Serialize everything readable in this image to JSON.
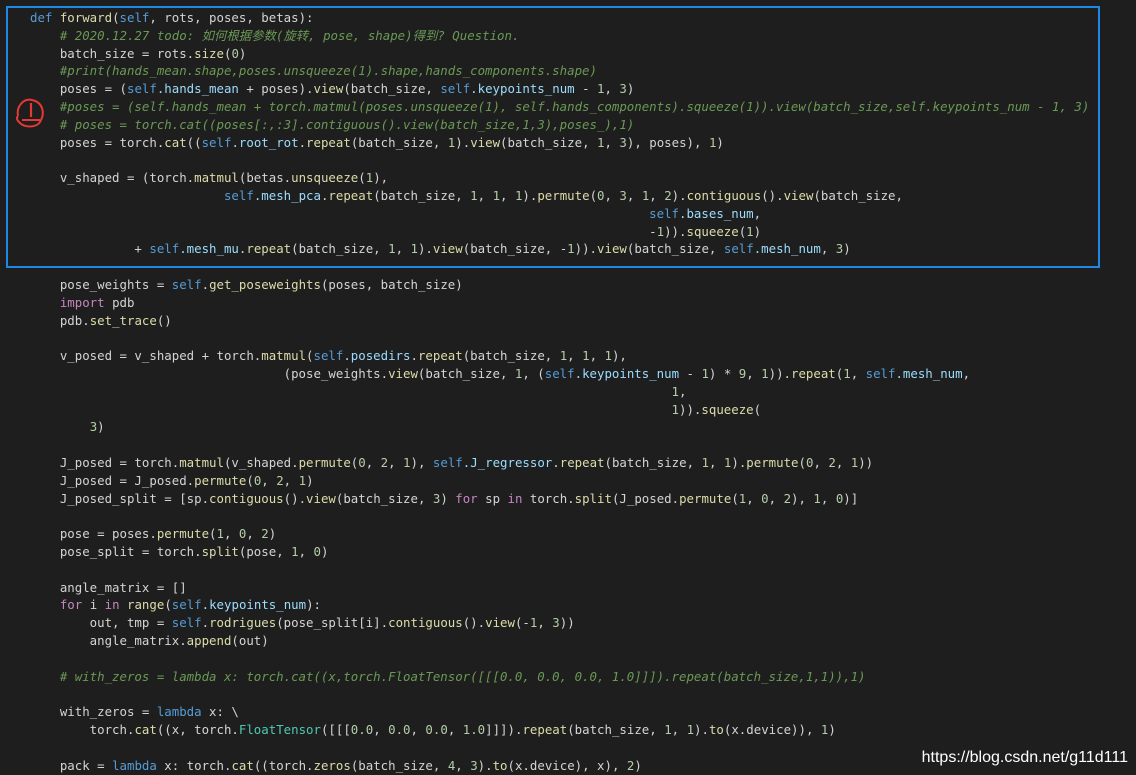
{
  "colors": {
    "background": "#1e1e1e",
    "keyword": "#569cd6",
    "control": "#c586c0",
    "function": "#dcdcaa",
    "attribute": "#9cdcfe",
    "number": "#b5cea8",
    "comment": "#6a9955",
    "highlight_box": "#1e88e5",
    "annotation_mark": "#e53935"
  },
  "code_lines": [
    [
      {
        "t": "def ",
        "c": "kw"
      },
      {
        "t": "forward",
        "c": "fn"
      },
      {
        "t": "(",
        "c": ""
      },
      {
        "t": "self",
        "c": "kw"
      },
      {
        "t": ", rots, poses, betas):",
        "c": ""
      }
    ],
    [
      {
        "t": "    # 2020.12.27 todo: 如何根据参数(旋转, pose, shape)得到? Question.",
        "c": "cm"
      }
    ],
    [
      {
        "t": "    batch_size = rots.",
        "c": ""
      },
      {
        "t": "size",
        "c": "fn"
      },
      {
        "t": "(",
        "c": ""
      },
      {
        "t": "0",
        "c": "num"
      },
      {
        "t": ")",
        "c": ""
      }
    ],
    [
      {
        "t": "    #print(hands_mean.shape,poses.unsqueeze(1).shape,hands_components.shape)",
        "c": "cm"
      }
    ],
    [
      {
        "t": "    poses = (",
        "c": ""
      },
      {
        "t": "self",
        "c": "kw"
      },
      {
        "t": ".hands_mean",
        "c": "attr"
      },
      {
        "t": " + poses).",
        "c": ""
      },
      {
        "t": "view",
        "c": "fn"
      },
      {
        "t": "(batch_size, ",
        "c": ""
      },
      {
        "t": "self",
        "c": "kw"
      },
      {
        "t": ".keypoints_num",
        "c": "attr"
      },
      {
        "t": " - ",
        "c": ""
      },
      {
        "t": "1",
        "c": "num"
      },
      {
        "t": ", ",
        "c": ""
      },
      {
        "t": "3",
        "c": "num"
      },
      {
        "t": ")",
        "c": ""
      }
    ],
    [
      {
        "t": "    #poses = (self.hands_mean + torch.matmul(poses.unsqueeze(1), self.hands_components).squeeze(1)).view(batch_size,self.keypoints_num - 1, 3)",
        "c": "cm"
      }
    ],
    [
      {
        "t": "    # poses = torch.cat((poses[:,:3].contiguous().view(batch_size,1,3),poses_),1)",
        "c": "cm"
      }
    ],
    [
      {
        "t": "    poses = torch.",
        "c": ""
      },
      {
        "t": "cat",
        "c": "fn"
      },
      {
        "t": "((",
        "c": ""
      },
      {
        "t": "self",
        "c": "kw"
      },
      {
        "t": ".root_rot",
        "c": "attr"
      },
      {
        "t": ".",
        "c": ""
      },
      {
        "t": "repeat",
        "c": "fn"
      },
      {
        "t": "(batch_size, ",
        "c": ""
      },
      {
        "t": "1",
        "c": "num"
      },
      {
        "t": ").",
        "c": ""
      },
      {
        "t": "view",
        "c": "fn"
      },
      {
        "t": "(batch_size, ",
        "c": ""
      },
      {
        "t": "1",
        "c": "num"
      },
      {
        "t": ", ",
        "c": ""
      },
      {
        "t": "3",
        "c": "num"
      },
      {
        "t": "), poses), ",
        "c": ""
      },
      {
        "t": "1",
        "c": "num"
      },
      {
        "t": ")",
        "c": ""
      }
    ],
    [
      {
        "t": "",
        "c": ""
      }
    ],
    [
      {
        "t": "    v_shaped = (torch.",
        "c": ""
      },
      {
        "t": "matmul",
        "c": "fn"
      },
      {
        "t": "(betas.",
        "c": ""
      },
      {
        "t": "unsqueeze",
        "c": "fn"
      },
      {
        "t": "(",
        "c": ""
      },
      {
        "t": "1",
        "c": "num"
      },
      {
        "t": "),",
        "c": ""
      }
    ],
    [
      {
        "t": "                          ",
        "c": ""
      },
      {
        "t": "self",
        "c": "kw"
      },
      {
        "t": ".mesh_pca",
        "c": "attr"
      },
      {
        "t": ".",
        "c": ""
      },
      {
        "t": "repeat",
        "c": "fn"
      },
      {
        "t": "(batch_size, ",
        "c": ""
      },
      {
        "t": "1",
        "c": "num"
      },
      {
        "t": ", ",
        "c": ""
      },
      {
        "t": "1",
        "c": "num"
      },
      {
        "t": ", ",
        "c": ""
      },
      {
        "t": "1",
        "c": "num"
      },
      {
        "t": ").",
        "c": ""
      },
      {
        "t": "permute",
        "c": "fn"
      },
      {
        "t": "(",
        "c": ""
      },
      {
        "t": "0",
        "c": "num"
      },
      {
        "t": ", ",
        "c": ""
      },
      {
        "t": "3",
        "c": "num"
      },
      {
        "t": ", ",
        "c": ""
      },
      {
        "t": "1",
        "c": "num"
      },
      {
        "t": ", ",
        "c": ""
      },
      {
        "t": "2",
        "c": "num"
      },
      {
        "t": ").",
        "c": ""
      },
      {
        "t": "contiguous",
        "c": "fn"
      },
      {
        "t": "().",
        "c": ""
      },
      {
        "t": "view",
        "c": "fn"
      },
      {
        "t": "(batch_size,",
        "c": ""
      }
    ],
    [
      {
        "t": "                                                                                   ",
        "c": ""
      },
      {
        "t": "self",
        "c": "kw"
      },
      {
        "t": ".bases_num",
        "c": "attr"
      },
      {
        "t": ",",
        "c": ""
      }
    ],
    [
      {
        "t": "                                                                                   -",
        "c": ""
      },
      {
        "t": "1",
        "c": "num"
      },
      {
        "t": ")).",
        "c": ""
      },
      {
        "t": "squeeze",
        "c": "fn"
      },
      {
        "t": "(",
        "c": ""
      },
      {
        "t": "1",
        "c": "num"
      },
      {
        "t": ")",
        "c": ""
      }
    ],
    [
      {
        "t": "              + ",
        "c": ""
      },
      {
        "t": "self",
        "c": "kw"
      },
      {
        "t": ".mesh_mu",
        "c": "attr"
      },
      {
        "t": ".",
        "c": ""
      },
      {
        "t": "repeat",
        "c": "fn"
      },
      {
        "t": "(batch_size, ",
        "c": ""
      },
      {
        "t": "1",
        "c": "num"
      },
      {
        "t": ", ",
        "c": ""
      },
      {
        "t": "1",
        "c": "num"
      },
      {
        "t": ").",
        "c": ""
      },
      {
        "t": "view",
        "c": "fn"
      },
      {
        "t": "(batch_size, -",
        "c": ""
      },
      {
        "t": "1",
        "c": "num"
      },
      {
        "t": ")).",
        "c": ""
      },
      {
        "t": "view",
        "c": "fn"
      },
      {
        "t": "(batch_size, ",
        "c": ""
      },
      {
        "t": "self",
        "c": "kw"
      },
      {
        "t": ".mesh_num",
        "c": "attr"
      },
      {
        "t": ", ",
        "c": ""
      },
      {
        "t": "3",
        "c": "num"
      },
      {
        "t": ")",
        "c": ""
      }
    ],
    [
      {
        "t": "",
        "c": ""
      }
    ],
    [
      {
        "t": "    pose_weights = ",
        "c": ""
      },
      {
        "t": "self",
        "c": "kw"
      },
      {
        "t": ".",
        "c": ""
      },
      {
        "t": "get_poseweights",
        "c": "fn"
      },
      {
        "t": "(poses, batch_size)",
        "c": ""
      }
    ],
    [
      {
        "t": "    ",
        "c": ""
      },
      {
        "t": "import",
        "c": "ctl"
      },
      {
        "t": " pdb",
        "c": ""
      }
    ],
    [
      {
        "t": "    pdb.",
        "c": ""
      },
      {
        "t": "set_trace",
        "c": "fn"
      },
      {
        "t": "()",
        "c": ""
      }
    ],
    [
      {
        "t": "",
        "c": ""
      }
    ],
    [
      {
        "t": "    v_posed = v_shaped + torch.",
        "c": ""
      },
      {
        "t": "matmul",
        "c": "fn"
      },
      {
        "t": "(",
        "c": ""
      },
      {
        "t": "self",
        "c": "kw"
      },
      {
        "t": ".posedirs",
        "c": "attr"
      },
      {
        "t": ".",
        "c": ""
      },
      {
        "t": "repeat",
        "c": "fn"
      },
      {
        "t": "(batch_size, ",
        "c": ""
      },
      {
        "t": "1",
        "c": "num"
      },
      {
        "t": ", ",
        "c": ""
      },
      {
        "t": "1",
        "c": "num"
      },
      {
        "t": ", ",
        "c": ""
      },
      {
        "t": "1",
        "c": "num"
      },
      {
        "t": "),",
        "c": ""
      }
    ],
    [
      {
        "t": "                                  (pose_weights.",
        "c": ""
      },
      {
        "t": "view",
        "c": "fn"
      },
      {
        "t": "(batch_size, ",
        "c": ""
      },
      {
        "t": "1",
        "c": "num"
      },
      {
        "t": ", (",
        "c": ""
      },
      {
        "t": "self",
        "c": "kw"
      },
      {
        "t": ".keypoints_num",
        "c": "attr"
      },
      {
        "t": " - ",
        "c": ""
      },
      {
        "t": "1",
        "c": "num"
      },
      {
        "t": ") * ",
        "c": ""
      },
      {
        "t": "9",
        "c": "num"
      },
      {
        "t": ", ",
        "c": ""
      },
      {
        "t": "1",
        "c": "num"
      },
      {
        "t": ")).",
        "c": ""
      },
      {
        "t": "repeat",
        "c": "fn"
      },
      {
        "t": "(",
        "c": ""
      },
      {
        "t": "1",
        "c": "num"
      },
      {
        "t": ", ",
        "c": ""
      },
      {
        "t": "self",
        "c": "kw"
      },
      {
        "t": ".mesh_num",
        "c": "attr"
      },
      {
        "t": ",",
        "c": ""
      }
    ],
    [
      {
        "t": "                                                                                      ",
        "c": ""
      },
      {
        "t": "1",
        "c": "num"
      },
      {
        "t": ",",
        "c": ""
      }
    ],
    [
      {
        "t": "                                                                                      ",
        "c": ""
      },
      {
        "t": "1",
        "c": "num"
      },
      {
        "t": ")).",
        "c": ""
      },
      {
        "t": "squeeze",
        "c": "fn"
      },
      {
        "t": "(",
        "c": ""
      }
    ],
    [
      {
        "t": "        ",
        "c": ""
      },
      {
        "t": "3",
        "c": "num"
      },
      {
        "t": ")",
        "c": ""
      }
    ],
    [
      {
        "t": "",
        "c": ""
      }
    ],
    [
      {
        "t": "    J_posed = torch.",
        "c": ""
      },
      {
        "t": "matmul",
        "c": "fn"
      },
      {
        "t": "(v_shaped.",
        "c": ""
      },
      {
        "t": "permute",
        "c": "fn"
      },
      {
        "t": "(",
        "c": ""
      },
      {
        "t": "0",
        "c": "num"
      },
      {
        "t": ", ",
        "c": ""
      },
      {
        "t": "2",
        "c": "num"
      },
      {
        "t": ", ",
        "c": ""
      },
      {
        "t": "1",
        "c": "num"
      },
      {
        "t": "), ",
        "c": ""
      },
      {
        "t": "self",
        "c": "kw"
      },
      {
        "t": ".J_regressor",
        "c": "attr"
      },
      {
        "t": ".",
        "c": ""
      },
      {
        "t": "repeat",
        "c": "fn"
      },
      {
        "t": "(batch_size, ",
        "c": ""
      },
      {
        "t": "1",
        "c": "num"
      },
      {
        "t": ", ",
        "c": ""
      },
      {
        "t": "1",
        "c": "num"
      },
      {
        "t": ").",
        "c": ""
      },
      {
        "t": "permute",
        "c": "fn"
      },
      {
        "t": "(",
        "c": ""
      },
      {
        "t": "0",
        "c": "num"
      },
      {
        "t": ", ",
        "c": ""
      },
      {
        "t": "2",
        "c": "num"
      },
      {
        "t": ", ",
        "c": ""
      },
      {
        "t": "1",
        "c": "num"
      },
      {
        "t": "))",
        "c": ""
      }
    ],
    [
      {
        "t": "    J_posed = J_posed.",
        "c": ""
      },
      {
        "t": "permute",
        "c": "fn"
      },
      {
        "t": "(",
        "c": ""
      },
      {
        "t": "0",
        "c": "num"
      },
      {
        "t": ", ",
        "c": ""
      },
      {
        "t": "2",
        "c": "num"
      },
      {
        "t": ", ",
        "c": ""
      },
      {
        "t": "1",
        "c": "num"
      },
      {
        "t": ")",
        "c": ""
      }
    ],
    [
      {
        "t": "    J_posed_split = [sp.",
        "c": ""
      },
      {
        "t": "contiguous",
        "c": "fn"
      },
      {
        "t": "().",
        "c": ""
      },
      {
        "t": "view",
        "c": "fn"
      },
      {
        "t": "(batch_size, ",
        "c": ""
      },
      {
        "t": "3",
        "c": "num"
      },
      {
        "t": ") ",
        "c": ""
      },
      {
        "t": "for",
        "c": "ctl"
      },
      {
        "t": " sp ",
        "c": ""
      },
      {
        "t": "in",
        "c": "ctl"
      },
      {
        "t": " torch.",
        "c": ""
      },
      {
        "t": "split",
        "c": "fn"
      },
      {
        "t": "(J_posed.",
        "c": ""
      },
      {
        "t": "permute",
        "c": "fn"
      },
      {
        "t": "(",
        "c": ""
      },
      {
        "t": "1",
        "c": "num"
      },
      {
        "t": ", ",
        "c": ""
      },
      {
        "t": "0",
        "c": "num"
      },
      {
        "t": ", ",
        "c": ""
      },
      {
        "t": "2",
        "c": "num"
      },
      {
        "t": "), ",
        "c": ""
      },
      {
        "t": "1",
        "c": "num"
      },
      {
        "t": ", ",
        "c": ""
      },
      {
        "t": "0",
        "c": "num"
      },
      {
        "t": ")]",
        "c": ""
      }
    ],
    [
      {
        "t": "",
        "c": ""
      }
    ],
    [
      {
        "t": "    pose = poses.",
        "c": ""
      },
      {
        "t": "permute",
        "c": "fn"
      },
      {
        "t": "(",
        "c": ""
      },
      {
        "t": "1",
        "c": "num"
      },
      {
        "t": ", ",
        "c": ""
      },
      {
        "t": "0",
        "c": "num"
      },
      {
        "t": ", ",
        "c": ""
      },
      {
        "t": "2",
        "c": "num"
      },
      {
        "t": ")",
        "c": ""
      }
    ],
    [
      {
        "t": "    pose_split = torch.",
        "c": ""
      },
      {
        "t": "split",
        "c": "fn"
      },
      {
        "t": "(pose, ",
        "c": ""
      },
      {
        "t": "1",
        "c": "num"
      },
      {
        "t": ", ",
        "c": ""
      },
      {
        "t": "0",
        "c": "num"
      },
      {
        "t": ")",
        "c": ""
      }
    ],
    [
      {
        "t": "",
        "c": ""
      }
    ],
    [
      {
        "t": "    angle_matrix = []",
        "c": ""
      }
    ],
    [
      {
        "t": "    ",
        "c": ""
      },
      {
        "t": "for",
        "c": "ctl"
      },
      {
        "t": " i ",
        "c": ""
      },
      {
        "t": "in",
        "c": "ctl"
      },
      {
        "t": " ",
        "c": ""
      },
      {
        "t": "range",
        "c": "fn"
      },
      {
        "t": "(",
        "c": ""
      },
      {
        "t": "self",
        "c": "kw"
      },
      {
        "t": ".keypoints_num",
        "c": "attr"
      },
      {
        "t": "):",
        "c": ""
      }
    ],
    [
      {
        "t": "        out, tmp = ",
        "c": ""
      },
      {
        "t": "self",
        "c": "kw"
      },
      {
        "t": ".",
        "c": ""
      },
      {
        "t": "rodrigues",
        "c": "fn"
      },
      {
        "t": "(pose_split[i].",
        "c": ""
      },
      {
        "t": "contiguous",
        "c": "fn"
      },
      {
        "t": "().",
        "c": ""
      },
      {
        "t": "view",
        "c": "fn"
      },
      {
        "t": "(-",
        "c": ""
      },
      {
        "t": "1",
        "c": "num"
      },
      {
        "t": ", ",
        "c": ""
      },
      {
        "t": "3",
        "c": "num"
      },
      {
        "t": "))",
        "c": ""
      }
    ],
    [
      {
        "t": "        angle_matrix.",
        "c": ""
      },
      {
        "t": "append",
        "c": "fn"
      },
      {
        "t": "(out)",
        "c": ""
      }
    ],
    [
      {
        "t": "",
        "c": ""
      }
    ],
    [
      {
        "t": "    # with_zeros = lambda x: torch.cat((x,torch.FloatTensor([[[0.0, 0.0, 0.0, 1.0]]]).repeat(batch_size,1,1)),1)",
        "c": "cm"
      }
    ],
    [
      {
        "t": "",
        "c": ""
      }
    ],
    [
      {
        "t": "    with_zeros = ",
        "c": ""
      },
      {
        "t": "lambda",
        "c": "kw"
      },
      {
        "t": " x: \\",
        "c": ""
      }
    ],
    [
      {
        "t": "        torch.",
        "c": ""
      },
      {
        "t": "cat",
        "c": "fn"
      },
      {
        "t": "((x, torch.",
        "c": ""
      },
      {
        "t": "FloatTensor",
        "c": "hl"
      },
      {
        "t": "([[[",
        "c": ""
      },
      {
        "t": "0.0",
        "c": "num"
      },
      {
        "t": ", ",
        "c": ""
      },
      {
        "t": "0.0",
        "c": "num"
      },
      {
        "t": ", ",
        "c": ""
      },
      {
        "t": "0.0",
        "c": "num"
      },
      {
        "t": ", ",
        "c": ""
      },
      {
        "t": "1.0",
        "c": "num"
      },
      {
        "t": "]]]).",
        "c": ""
      },
      {
        "t": "repeat",
        "c": "fn"
      },
      {
        "t": "(batch_size, ",
        "c": ""
      },
      {
        "t": "1",
        "c": "num"
      },
      {
        "t": ", ",
        "c": ""
      },
      {
        "t": "1",
        "c": "num"
      },
      {
        "t": ").",
        "c": ""
      },
      {
        "t": "to",
        "c": "fn"
      },
      {
        "t": "(x.device)), ",
        "c": ""
      },
      {
        "t": "1",
        "c": "num"
      },
      {
        "t": ")",
        "c": ""
      }
    ],
    [
      {
        "t": "",
        "c": ""
      }
    ],
    [
      {
        "t": "    pack = ",
        "c": ""
      },
      {
        "t": "lambda",
        "c": "kw"
      },
      {
        "t": " x: torch.",
        "c": ""
      },
      {
        "t": "cat",
        "c": "fn"
      },
      {
        "t": "((torch.",
        "c": ""
      },
      {
        "t": "zeros",
        "c": "fn"
      },
      {
        "t": "(batch_size, ",
        "c": ""
      },
      {
        "t": "4",
        "c": "num"
      },
      {
        "t": ", ",
        "c": ""
      },
      {
        "t": "3",
        "c": "num"
      },
      {
        "t": ").",
        "c": ""
      },
      {
        "t": "to",
        "c": "fn"
      },
      {
        "t": "(x.device), x), ",
        "c": ""
      },
      {
        "t": "2",
        "c": "num"
      },
      {
        "t": ")",
        "c": ""
      }
    ]
  ],
  "annotation": {
    "icon": "exclamation-circle-icon"
  },
  "watermark": "https://blog.csdn.net/g11d111"
}
